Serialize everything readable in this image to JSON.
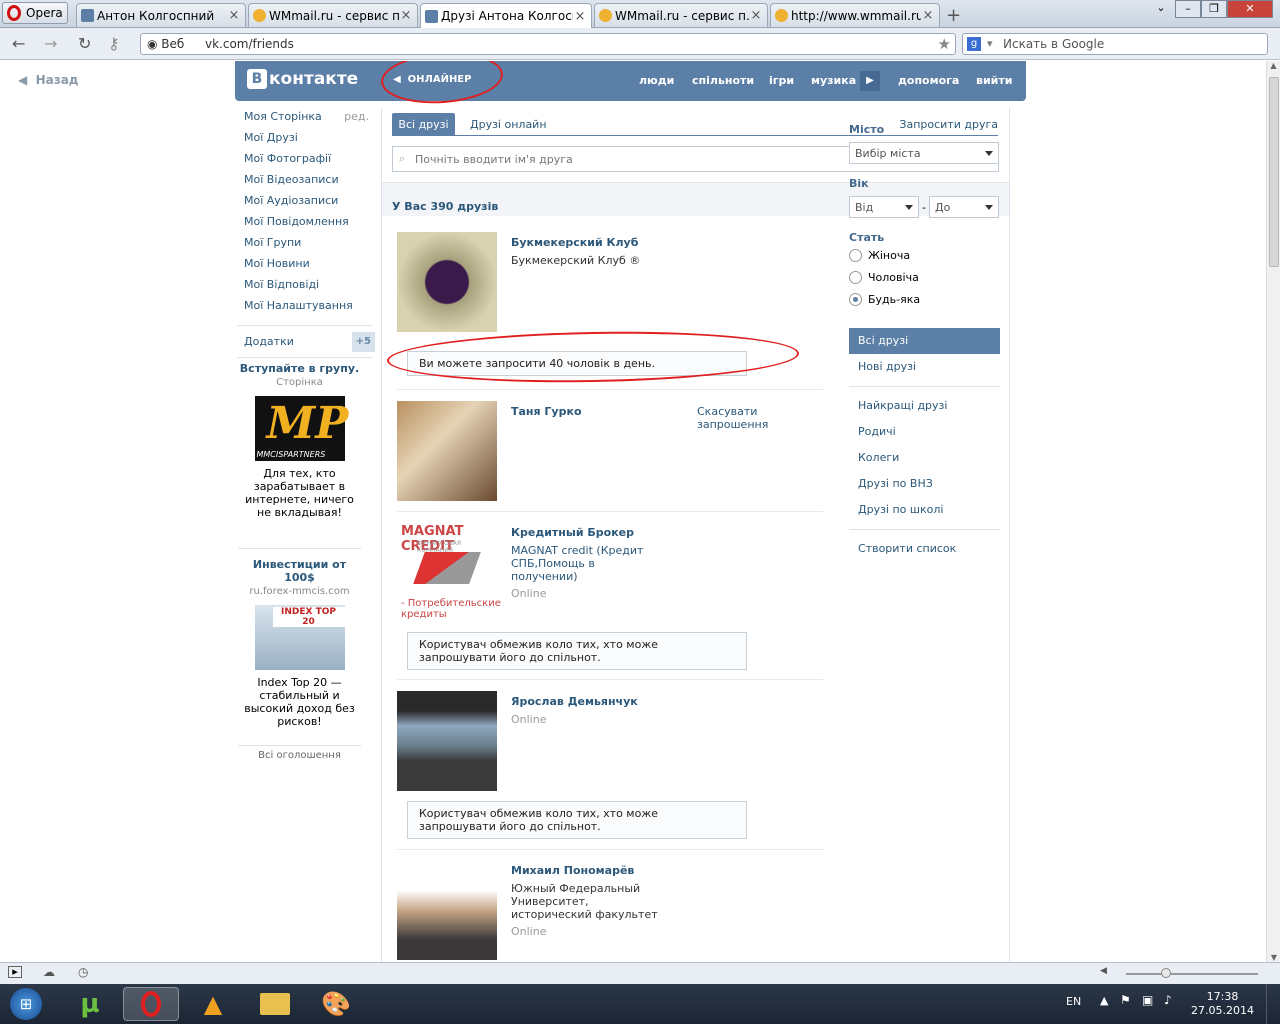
{
  "browser": {
    "menu_label": "Opera",
    "tabs": [
      {
        "title": "Антон Колгоспний",
        "favicon": "vk"
      },
      {
        "title": "WMmail.ru - сервис п...",
        "favicon": "wmmail"
      },
      {
        "title": "Друзі Антона Колгосп...",
        "favicon": "vk",
        "active": true
      },
      {
        "title": "WMmail.ru - сервис п...",
        "favicon": "wmmail"
      },
      {
        "title": "http://www.wmmail.ru...",
        "favicon": "wmmail"
      }
    ],
    "address_mode": "Веб",
    "url": "vk.com/friends",
    "search_placeholder": "Искать в Google"
  },
  "page": {
    "back_label": "Назад",
    "header": {
      "logo_text": "контакте",
      "logo_letter": "В",
      "player_label": "ОНЛАЙНЕР",
      "nav": [
        "люди",
        "спільноти",
        "ігри",
        "музика",
        "допомога",
        "вийти"
      ]
    },
    "left_menu": {
      "items": [
        "Моя Сторінка",
        "Мої Друзі",
        "Мої Фотографії",
        "Мої Відеозаписи",
        "Мої Аудіозаписи",
        "Мої Повідомлення",
        "Мої Групи",
        "Мої Новини",
        "Мої Відповіді",
        "Мої Налаштування"
      ],
      "edit_label": "ред.",
      "apps_label": "Додатки",
      "apps_count": "+5"
    },
    "ads": [
      {
        "title": "Вступайте в групу.",
        "subtitle": "Сторінка",
        "image_text": "MP",
        "image_caption": "MMCISPARTNERS",
        "text": "Для тех, кто зарабатывает в интернете, ничего не вкладывая!"
      },
      {
        "title": "Инвестиции от 100$",
        "subtitle": "ru.forex-mmcis.com",
        "image_text": "INDEX TOP 20",
        "text": "Index Top 20 — стабильный и высокий доход без рисков!"
      }
    ],
    "all_ads_label": "Всі оголошення",
    "friends": {
      "tabs": {
        "all": "Всі друзі",
        "online": "Друзі онлайн",
        "invite": "Запросити друга"
      },
      "search_placeholder": "Почніть вводити ім'я друга",
      "count_text": "У Вас 390 друзів",
      "list": [
        {
          "name": "Букмекерский Клуб",
          "info": "Букмекерский Клуб ®",
          "message": "Ви можете запросити 40 чоловік в день."
        },
        {
          "name": "Таня Гурко",
          "action": "Скасувати запрошення"
        },
        {
          "name": "Кредитный Брокер",
          "info": "MAGNAT credit (Кредит СПБ,Помощь в получении)",
          "status": "Online",
          "avatar_brand": "MAGNAT CREDIT",
          "avatar_sub": "ФИНАНСОВАЯ КОМПАНИЯ",
          "avatar_caption": "- Потребительские кредиты",
          "message": "Користувач обмежив коло тих, хто може запрошувати його до спільнот."
        },
        {
          "name": "Ярослав Демьянчук",
          "status": "Online",
          "message": "Користувач обмежив коло тих, хто може запрошувати його до спільнот."
        },
        {
          "name": "Михаил Пономарёв",
          "info": "Южный Федеральный Университет, исторический факультет",
          "status": "Online"
        }
      ]
    },
    "filters": {
      "city_label": "Місто",
      "city_value": "Вибір міста",
      "age_label": "Вік",
      "age_from": "Від",
      "age_to": "До",
      "sex_label": "Стать",
      "sex_options": [
        "Жіноча",
        "Чоловіча",
        "Будь-яка"
      ],
      "sex_selected": "Будь-яка",
      "links_a": [
        "Всі друзі",
        "Нові друзі"
      ],
      "links_b": [
        "Найкращі друзі",
        "Родичі",
        "Колеги",
        "Друзі по ВНЗ",
        "Друзі по школі"
      ],
      "create_list": "Створити список"
    }
  },
  "taskbar": {
    "lang": "EN",
    "time": "17:38",
    "date": "27.05.2014"
  },
  "colors": {
    "vk_blue": "#5b7fa6",
    "link": "#2b587a",
    "annotation_red": "#e02020"
  }
}
